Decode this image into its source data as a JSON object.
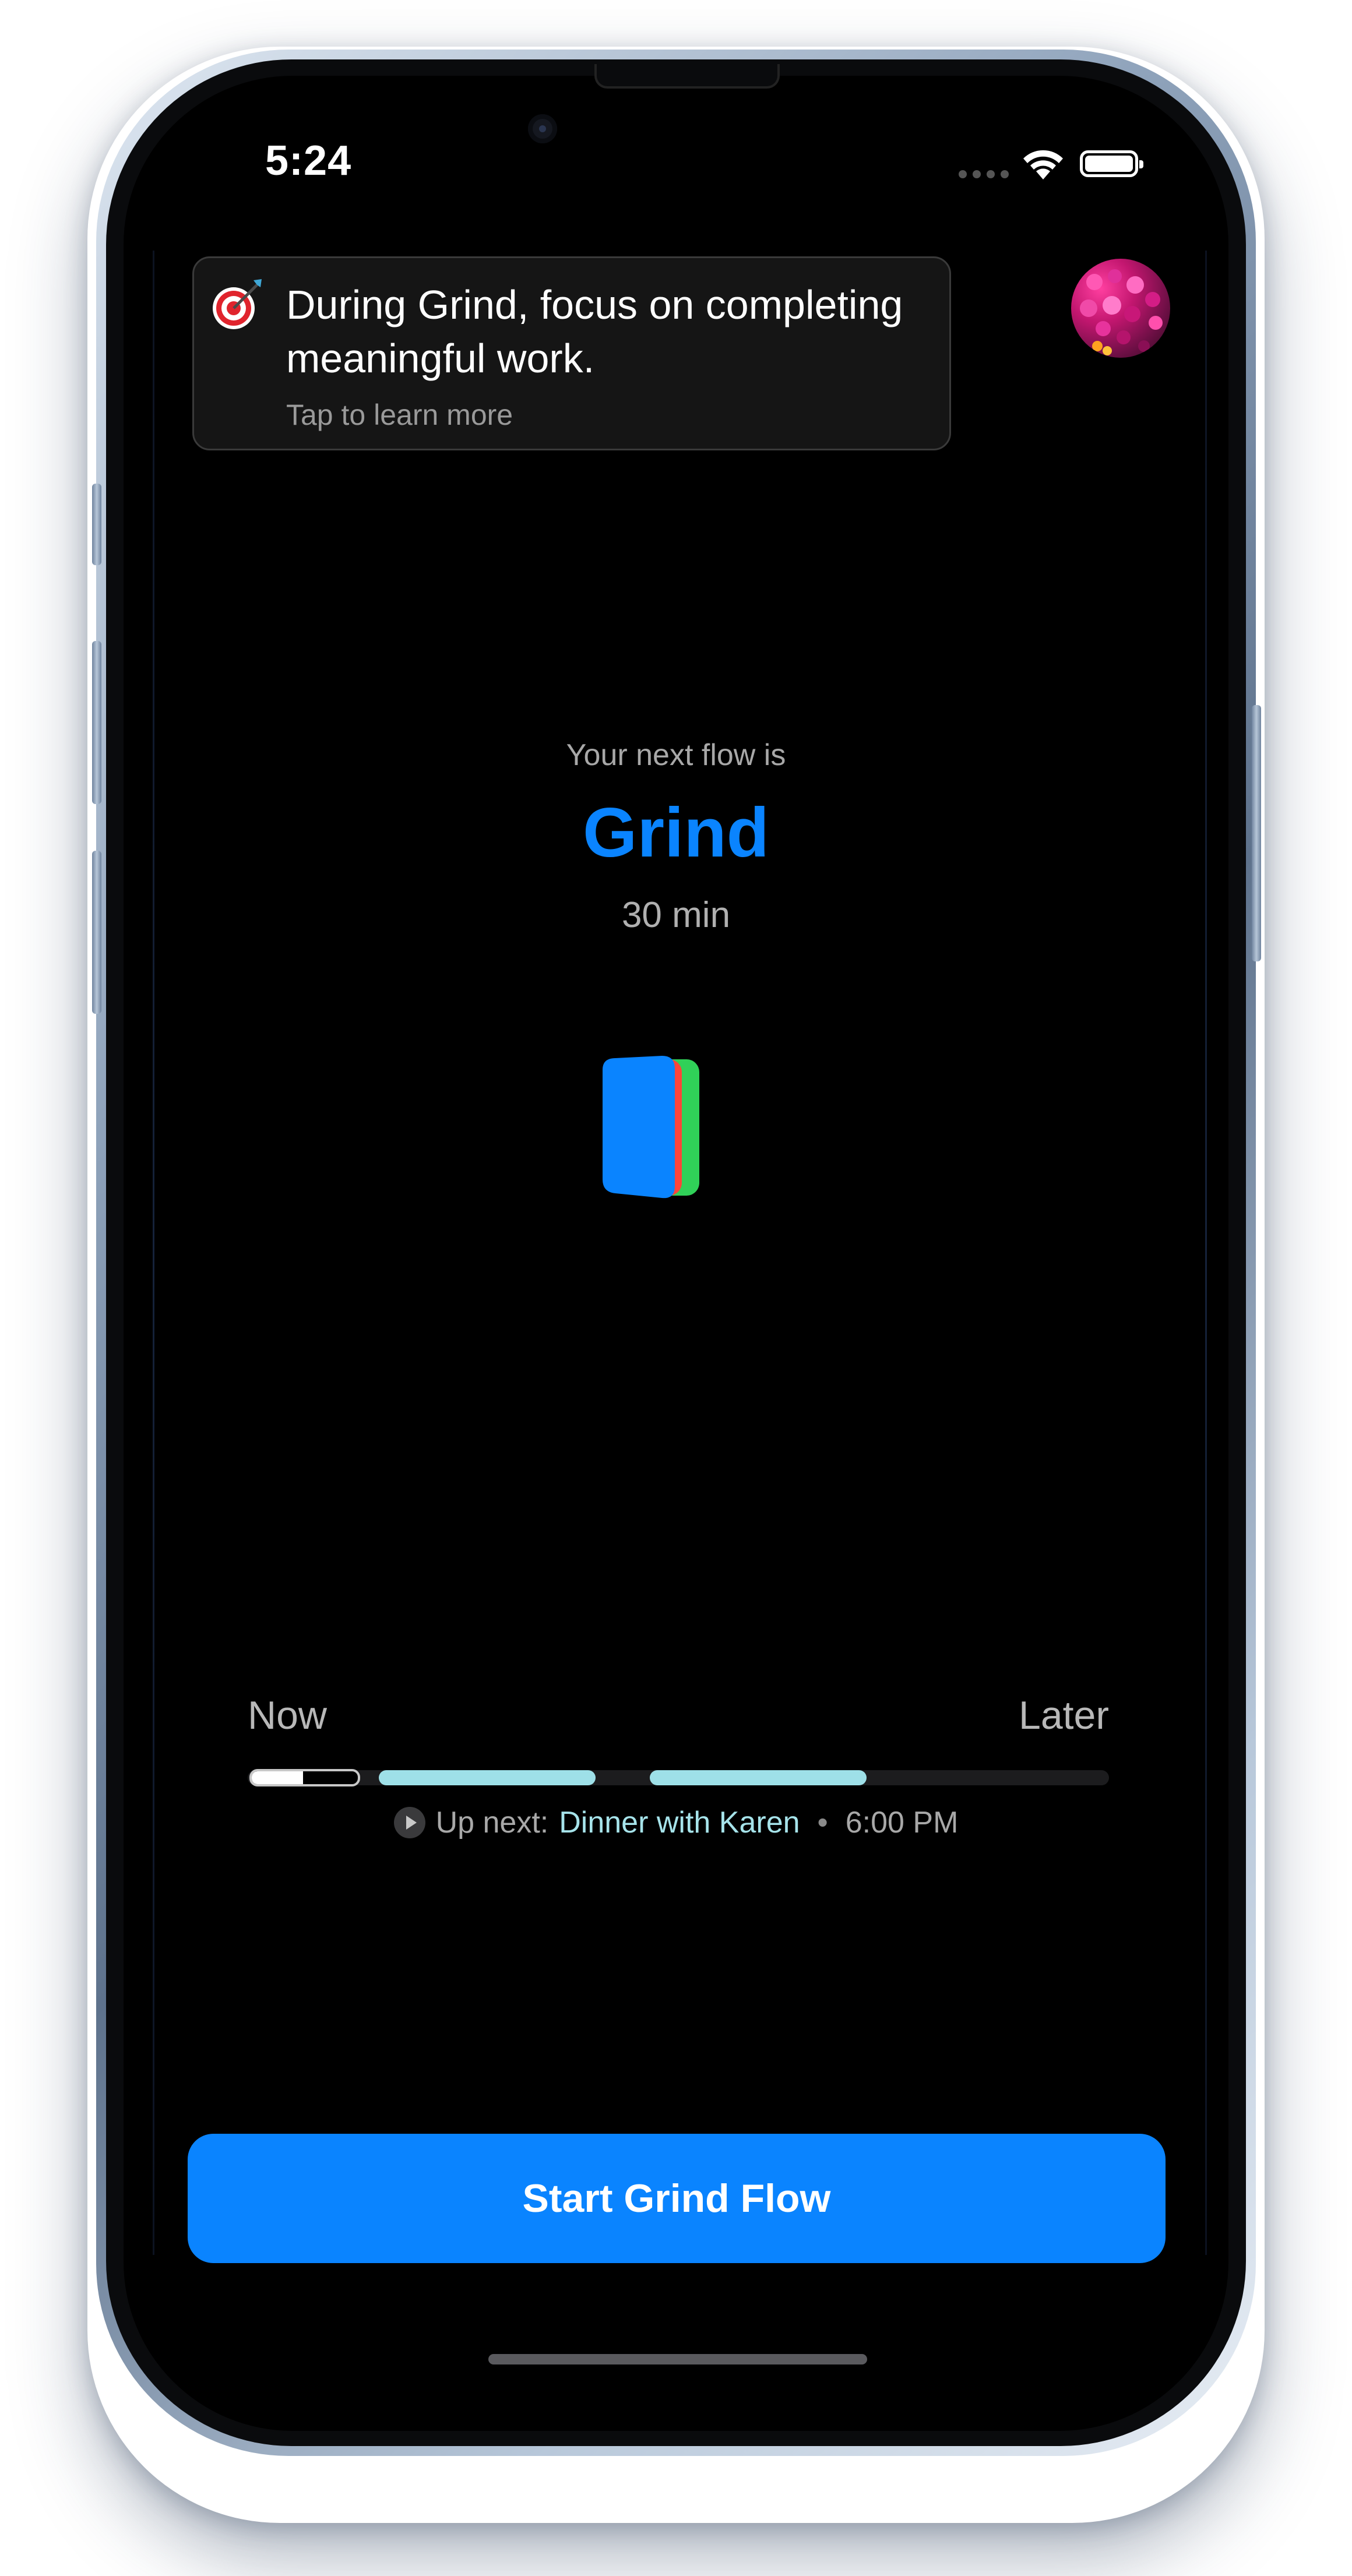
{
  "status_bar": {
    "time": "5:24"
  },
  "tip": {
    "emoji": "🎯",
    "text": "During Grind, focus on completing meaningful work.",
    "subtext": "Tap to learn more"
  },
  "next_flow": {
    "label": "Your next flow is",
    "name": "Grind",
    "duration": "30 min"
  },
  "timeline": {
    "start_label": "Now",
    "end_label": "Later",
    "up_next_prefix": "Up next:",
    "up_next_event": "Dinner with Karen",
    "separator": "•",
    "up_next_time": "6:00 PM"
  },
  "start_button": {
    "label": "Start Grind Flow"
  },
  "colors": {
    "accent_blue": "#0a84ff",
    "card_red": "#ff453a",
    "card_green": "#30d158",
    "timeline_cyan": "#9ee0e8"
  }
}
